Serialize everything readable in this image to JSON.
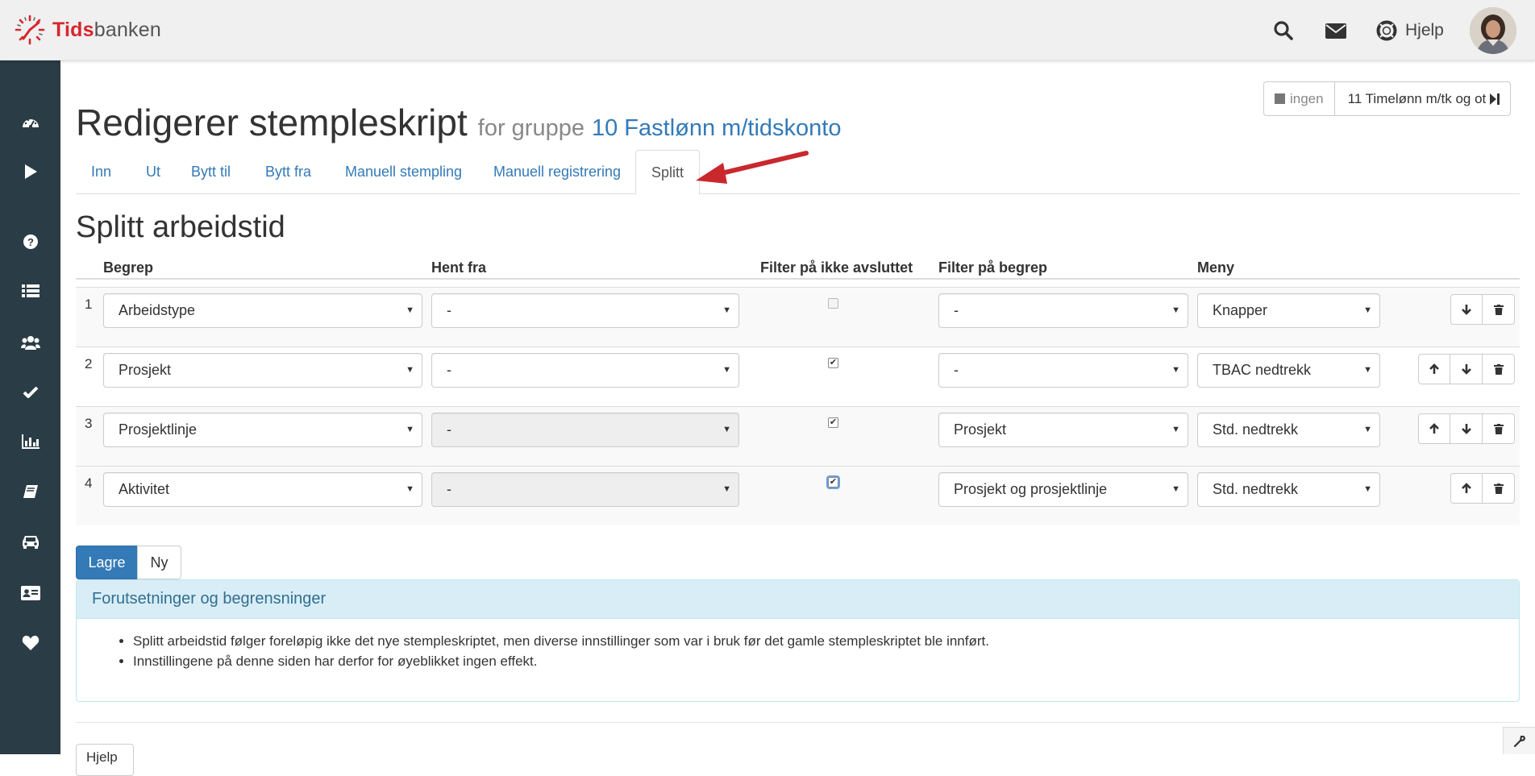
{
  "app": {
    "logo_part1": "Tids",
    "logo_part2": "banken",
    "help_label": "Hjelp"
  },
  "header": {
    "title": "Redigerer stempleskript",
    "for_group_label": "for gruppe",
    "group_link": "10 Fastlønn m/tidskonto",
    "group_nav_none": "ingen",
    "group_nav_next": "11 Timelønn m/tk og ot"
  },
  "tabs": [
    {
      "label": "Inn"
    },
    {
      "label": "Ut"
    },
    {
      "label": "Bytt til"
    },
    {
      "label": "Bytt fra"
    },
    {
      "label": "Manuell stempling"
    },
    {
      "label": "Manuell registrering"
    },
    {
      "label": "Splitt"
    }
  ],
  "active_tab": "Splitt",
  "section": {
    "title": "Splitt arbeidstid"
  },
  "table": {
    "headers": {
      "begrep": "Begrep",
      "hent_fra": "Hent fra",
      "filter_ikke_avsluttet": "Filter på ikke avsluttet",
      "filter_begrep": "Filter på begrep",
      "meny": "Meny"
    },
    "rows": [
      {
        "num": "1",
        "begrep": "Arbeidstype",
        "hent_fra": "-",
        "filter_ikke_avsluttet": false,
        "filter_begrep": "-",
        "meny": "Knapper"
      },
      {
        "num": "2",
        "begrep": "Prosjekt",
        "hent_fra": "-",
        "filter_ikke_avsluttet": true,
        "filter_begrep": "-",
        "meny": "TBAC nedtrekk"
      },
      {
        "num": "3",
        "begrep": "Prosjektlinje",
        "hent_fra": "-",
        "filter_ikke_avsluttet": true,
        "filter_begrep": "Prosjekt",
        "meny": "Std. nedtrekk"
      },
      {
        "num": "4",
        "begrep": "Aktivitet",
        "hent_fra": "-",
        "filter_ikke_avsluttet": true,
        "filter_begrep": "Prosjekt og prosjektlinje",
        "meny": "Std. nedtrekk"
      }
    ]
  },
  "actions": {
    "save_label": "Lagre",
    "new_label": "Ny"
  },
  "info_panel": {
    "title": "Forutsetninger og begrensninger",
    "items": [
      "Splitt arbeidstid følger foreløpig ikke det nye stempleskriptet, men diverse innstillinger som var i bruk før det gamle stempleskriptet ble innført.",
      "Innstillingene på denne siden har derfor for øyeblikket ingen effekt."
    ]
  },
  "bottom": {
    "button_label": "Hjelp"
  },
  "colors": {
    "sidebar": "#2a3c45",
    "accent": "#337ab7",
    "brand_red": "#d7262e",
    "annotation_arrow": "#c9282d",
    "info_bg": "#d9edf7"
  }
}
